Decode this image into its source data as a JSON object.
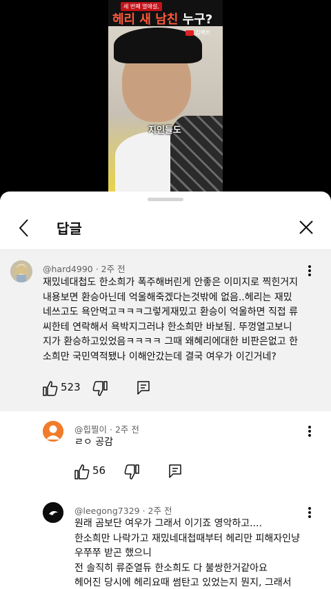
{
  "video": {
    "tag": "세 번째 열애설,",
    "title_red": "헤리 새 남친",
    "title_white": "누구?",
    "logo": "김팩트",
    "subtitle": "지인들도"
  },
  "sheet": {
    "title": "답글"
  },
  "main_comment": {
    "author": "@hard4990",
    "time": "2주 전",
    "lines": [
      "재밌네대첩도 한소희가 폭주해버린게 안좋은 이미지로 찍힌거지",
      "내용보면 환승아닌데 억울해죽겠다는것밖에 없음..헤리는 재밌",
      "네쓰고도 욕안먹고ㅋㅋㅋ그렇게재밌고 환승이 억울하면 직접 류",
      "씨한테 연락해서 욕박지그러냐 한소희만 바보됨. 뚜껑열고보니",
      "지가 환승하고있었음ㅋㅋㅋㅋ 그때 왜혜리에대한 비판은없고 한",
      "소희만 국민역적됐나 이해안갔는데 결국 여우가 이긴거네?"
    ],
    "likes": "523"
  },
  "reply1": {
    "author": "@힙찔이",
    "time": "2주 전",
    "text": "ㄹㅇ 공감",
    "likes": "56"
  },
  "reply2": {
    "author": "@leegong7329",
    "time": "2주 전",
    "lines": [
      "원래 곰보단 여우가 그래서 이기죠 영악하고....",
      "한소희만 나락가고 재밌네대첩때부터 헤리만 피해자인냥",
      "우쭈쭈 받곤 했으니",
      "전 솔직히 류준열듀 한소희도 다 불쌍한거같아요",
      "헤어진 당시에 헤리요때 썸탄고 있었는지 뭔지, 그래서"
    ]
  },
  "colors": {
    "sheet_bg": "#ffffff",
    "highlight_bg": "#f2f2f2",
    "text": "#0f0f0f",
    "meta": "#606060"
  },
  "icons": [
    "back-arrow-icon",
    "close-icon",
    "more-vert-icon",
    "thumb-up-icon",
    "thumb-down-icon",
    "reply-icon"
  ]
}
